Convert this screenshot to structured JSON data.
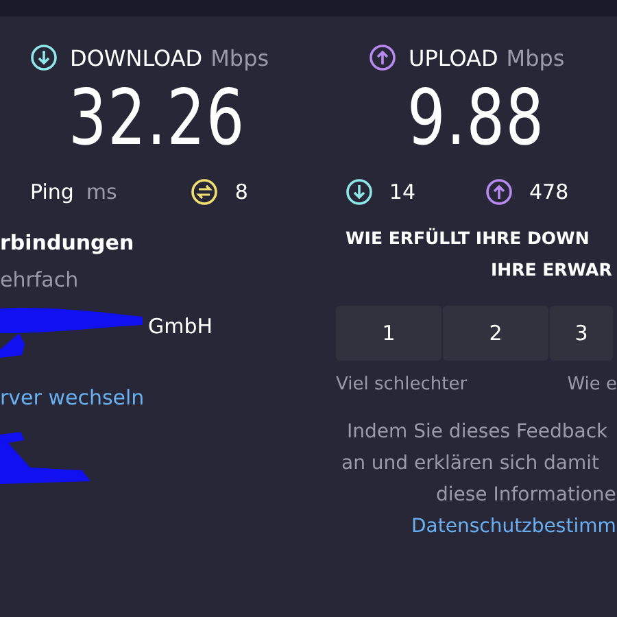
{
  "download": {
    "label": "DOWNLOAD",
    "unit": "Mbps",
    "value": "32.26"
  },
  "upload": {
    "label": "UPLOAD",
    "unit": "Mbps",
    "value": "9.88"
  },
  "ping": {
    "label": "Ping",
    "unit": "ms",
    "stats": [
      {
        "kind": "idle",
        "value": "8"
      },
      {
        "kind": "down",
        "value": "14"
      },
      {
        "kind": "up",
        "value": "478"
      }
    ]
  },
  "connections": {
    "title": "rbindungen",
    "value": "ehrfach"
  },
  "server": {
    "provider": "GmbH",
    "change_link": "rver wechseln"
  },
  "feedback": {
    "question_lines": [
      "WIE ERFÜLLT IHRE DOWN",
      "IHRE ERWAR"
    ],
    "ratings": [
      {
        "label": "1",
        "selected": false
      },
      {
        "label": "2",
        "selected": false
      },
      {
        "label": "3",
        "selected": false
      }
    ],
    "scale_low": "Viel schlechter",
    "scale_mid": "Wie e",
    "notice_lines": [
      "Indem Sie dieses Feedback",
      "an und erklären sich damit",
      "diese Informatione"
    ],
    "privacy_link": "Datenschutzbestimm"
  }
}
